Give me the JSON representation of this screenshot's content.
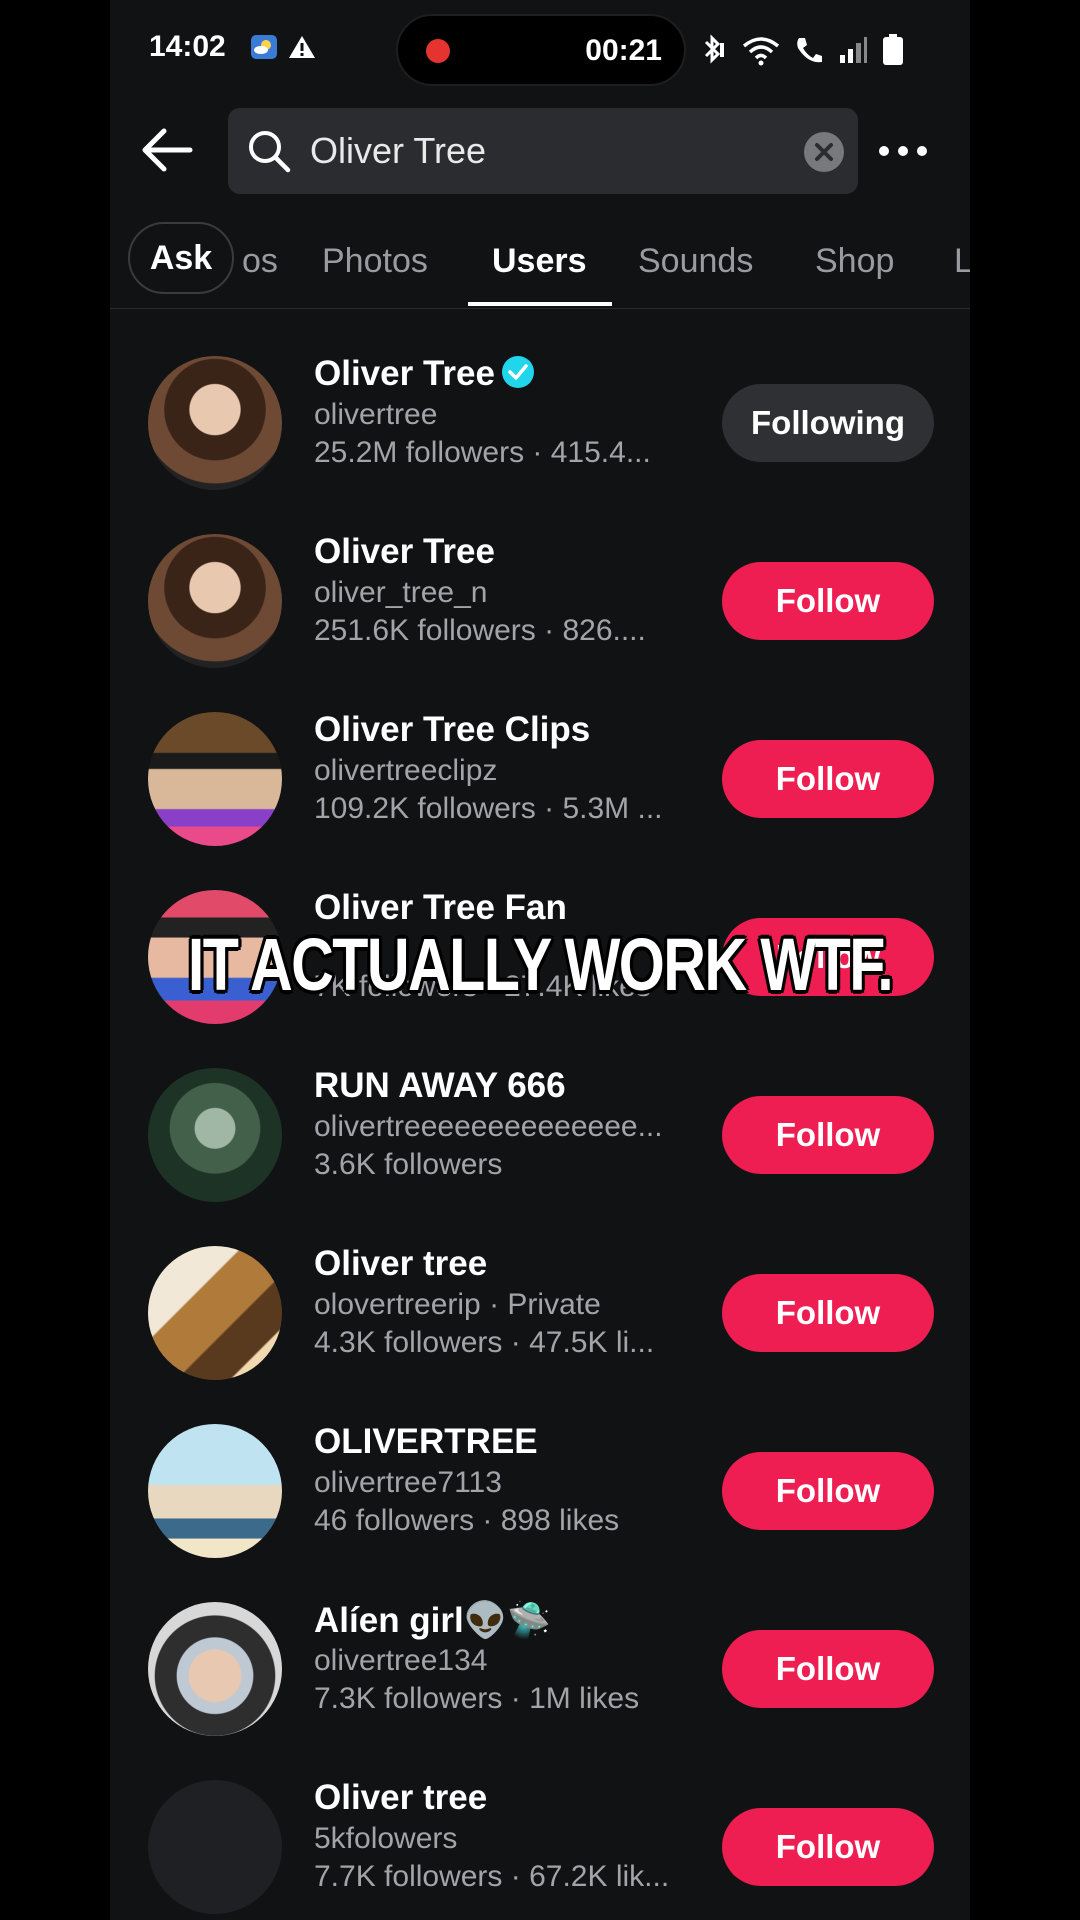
{
  "status_bar": {
    "time": "14:02",
    "recording_time": "00:21"
  },
  "search": {
    "query": "Oliver Tree"
  },
  "tabs": [
    {
      "label": "Ask"
    },
    {
      "label": "os"
    },
    {
      "label": "Photos"
    },
    {
      "label": "Users"
    },
    {
      "label": "Sounds"
    },
    {
      "label": "Shop"
    },
    {
      "label": "L"
    }
  ],
  "active_tab": "Users",
  "users": [
    {
      "name": "Oliver Tree",
      "verified": true,
      "handle": "olivertree",
      "stats": "25.2M followers · 415.4...",
      "button": "Following"
    },
    {
      "name": "Oliver Tree",
      "handle": "oliver_tree_n",
      "stats": "251.6K followers · 826....",
      "button": "Follow"
    },
    {
      "name": "Oliver Tree Clips",
      "handle": "olivertreeclipz",
      "stats": "109.2K followers · 5.3M ...",
      "button": "Follow"
    },
    {
      "name": "Oliver Tree Fan",
      "handle": "",
      "stats": "7K followers · 27.4K likes",
      "button": "Follow"
    },
    {
      "name": "RUN AWAY 666",
      "handle": "olivertreeeeeeeeeeeeee...",
      "stats": "3.6K followers",
      "button": "Follow"
    },
    {
      "name": "Oliver tree",
      "handle": "olovertreerip · Private",
      "stats": "4.3K followers · 47.5K li...",
      "button": "Follow"
    },
    {
      "name": "OLIVERTREE",
      "handle": "olivertree7113",
      "stats": "46 followers · 898 likes",
      "button": "Follow"
    },
    {
      "name": "Alíen girl👽🛸",
      "handle": "olivertree134",
      "stats": "7.3K followers · 1M likes",
      "button": "Follow"
    },
    {
      "name": "Oliver tree",
      "handle": "5kfolowers",
      "stats": "7.7K followers · 67.2K lik...",
      "button": "Follow"
    }
  ],
  "caption": "IT ACTUALLY WORK WTF.",
  "colors": {
    "follow": "#ee1d52",
    "following": "#2f3033",
    "verified": "#20d5ec",
    "background": "#111214"
  }
}
